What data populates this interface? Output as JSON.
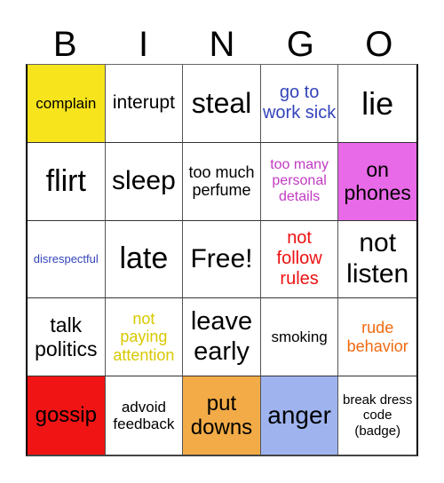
{
  "header": {
    "letters": [
      "B",
      "I",
      "N",
      "G",
      "O"
    ]
  },
  "cells": [
    {
      "text": "complain",
      "bg": "#f7e41d",
      "color": "#000000",
      "size": 17
    },
    {
      "text": "interupt",
      "bg": "#ffffff",
      "color": "#000000",
      "size": 21
    },
    {
      "text": "steal",
      "bg": "#ffffff",
      "color": "#000000",
      "size": 32
    },
    {
      "text": "go to work sick",
      "bg": "#ffffff",
      "color": "#3344bb",
      "size": 20
    },
    {
      "text": "lie",
      "bg": "#ffffff",
      "color": "#000000",
      "size": 36
    },
    {
      "text": "flirt",
      "bg": "#ffffff",
      "color": "#000000",
      "size": 34
    },
    {
      "text": "sleep",
      "bg": "#ffffff",
      "color": "#000000",
      "size": 30
    },
    {
      "text": "too much perfume",
      "bg": "#ffffff",
      "color": "#000000",
      "size": 18
    },
    {
      "text": "too many personal details",
      "bg": "#ffffff",
      "color": "#c23ac2",
      "size": 16
    },
    {
      "text": "on phones",
      "bg": "#e86ae8",
      "color": "#000000",
      "size": 23
    },
    {
      "text": "disrespectful",
      "bg": "#ffffff",
      "color": "#3344bb",
      "size": 13
    },
    {
      "text": "late",
      "bg": "#ffffff",
      "color": "#000000",
      "size": 34
    },
    {
      "text": "Free!",
      "bg": "#ffffff",
      "color": "#000000",
      "size": 30
    },
    {
      "text": "not follow rules",
      "bg": "#ffffff",
      "color": "#ee1111",
      "size": 20
    },
    {
      "text": "not listen",
      "bg": "#ffffff",
      "color": "#000000",
      "size": 30
    },
    {
      "text": "talk politics",
      "bg": "#ffffff",
      "color": "#000000",
      "size": 23
    },
    {
      "text": "not paying attention",
      "bg": "#ffffff",
      "color": "#d8c800",
      "size": 18
    },
    {
      "text": "leave early",
      "bg": "#ffffff",
      "color": "#000000",
      "size": 29
    },
    {
      "text": "smoking",
      "bg": "#ffffff",
      "color": "#000000",
      "size": 17
    },
    {
      "text": "rude behavior",
      "bg": "#ffffff",
      "color": "#f06a10",
      "size": 18
    },
    {
      "text": "gossip",
      "bg": "#f01414",
      "color": "#000000",
      "size": 24
    },
    {
      "text": "advoid feedback",
      "bg": "#ffffff",
      "color": "#000000",
      "size": 17
    },
    {
      "text": "put downs",
      "bg": "#f2ab46",
      "color": "#000000",
      "size": 24
    },
    {
      "text": "anger",
      "bg": "#9fb4ef",
      "color": "#000000",
      "size": 28
    },
    {
      "text": "break dress code (badge)",
      "bg": "#ffffff",
      "color": "#000000",
      "size": 15
    }
  ]
}
